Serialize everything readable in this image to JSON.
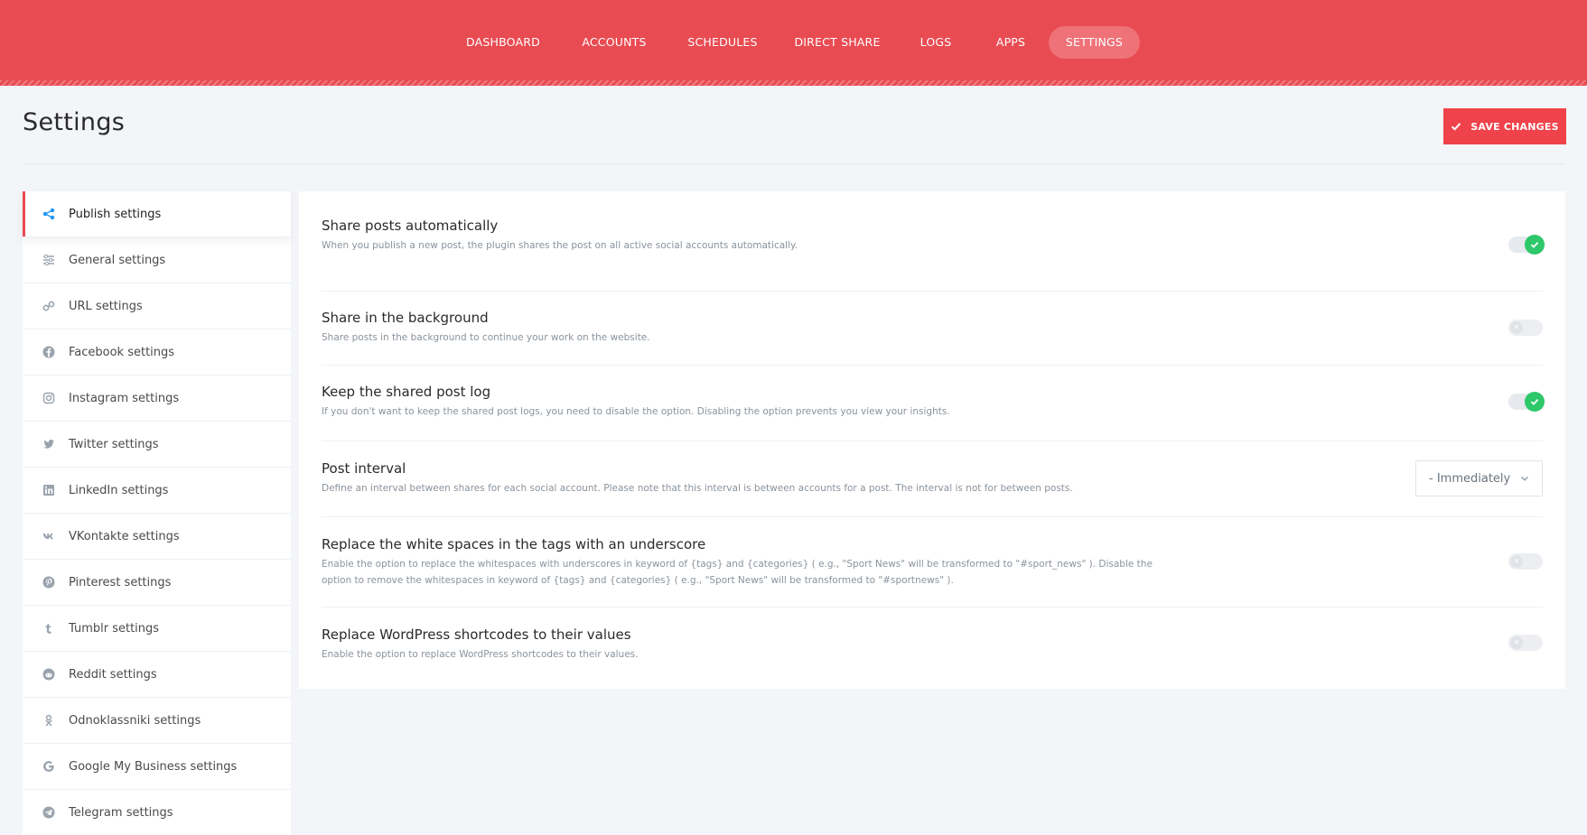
{
  "nav": {
    "items": [
      {
        "label": "DASHBOARD"
      },
      {
        "label": "ACCOUNTS"
      },
      {
        "label": "SCHEDULES"
      },
      {
        "label": "DIRECT SHARE"
      },
      {
        "label": "LOGS"
      },
      {
        "label": "APPS"
      },
      {
        "label": "SETTINGS"
      }
    ],
    "active": "SETTINGS"
  },
  "page": {
    "title": "Settings",
    "save_label": "SAVE CHANGES"
  },
  "sidebar": {
    "items": [
      {
        "label": "Publish settings",
        "icon": "share-icon"
      },
      {
        "label": "General settings",
        "icon": "sliders-icon"
      },
      {
        "label": "URL settings",
        "icon": "link-icon"
      },
      {
        "label": "Facebook settings",
        "icon": "facebook-icon"
      },
      {
        "label": "Instagram settings",
        "icon": "instagram-icon"
      },
      {
        "label": "Twitter settings",
        "icon": "twitter-icon"
      },
      {
        "label": "LinkedIn settings",
        "icon": "linkedin-icon"
      },
      {
        "label": "VKontakte settings",
        "icon": "vk-icon"
      },
      {
        "label": "Pinterest settings",
        "icon": "pinterest-icon"
      },
      {
        "label": "Tumblr settings",
        "icon": "tumblr-icon"
      },
      {
        "label": "Reddit settings",
        "icon": "reddit-icon"
      },
      {
        "label": "Odnoklassniki settings",
        "icon": "odnoklassniki-icon"
      },
      {
        "label": "Google My Business settings",
        "icon": "google-icon"
      },
      {
        "label": "Telegram settings",
        "icon": "telegram-icon"
      }
    ],
    "active": "Publish settings"
  },
  "options": [
    {
      "title": "Share posts automatically",
      "description": "When you publish a new post, the plugin shares the post on all active social accounts automatically.",
      "control": "toggle",
      "enabled": true
    },
    {
      "title": "Share in the background",
      "description": "Share posts in the background to continue your work on the website.",
      "control": "toggle",
      "enabled": false
    },
    {
      "title": "Keep the shared post log",
      "description": "If you don't want to keep the shared post logs, you need to disable the option. Disabling the option prevents you view your insights.",
      "control": "toggle",
      "enabled": true
    },
    {
      "title": "Post interval",
      "description": "Define an interval between shares for each social account. Please note that this interval is between accounts for a post. The interval is not for between posts.",
      "control": "select",
      "value": "- Immediately"
    },
    {
      "title": "Replace the white spaces in the tags with an underscore",
      "description": "Enable the option to replace the whitespaces with underscores in keyword of {tags} and {categories} ( e.g., \"Sport News\" will be transformed to \"#sport_news\" ). Disable the option to remove the whitespaces in keyword of {tags} and {categories} ( e.g., \"Sport News\" will be transformed to \"#sportnews\" ).",
      "control": "toggle",
      "enabled": false
    },
    {
      "title": "Replace WordPress shortcodes to their values",
      "description": "Enable the option to replace WordPress shortcodes to their values.",
      "control": "toggle",
      "enabled": false
    }
  ],
  "colors": {
    "brand": "#e94b52",
    "toggle_on": "#2ec76a",
    "active_icon": "#2196f3"
  }
}
